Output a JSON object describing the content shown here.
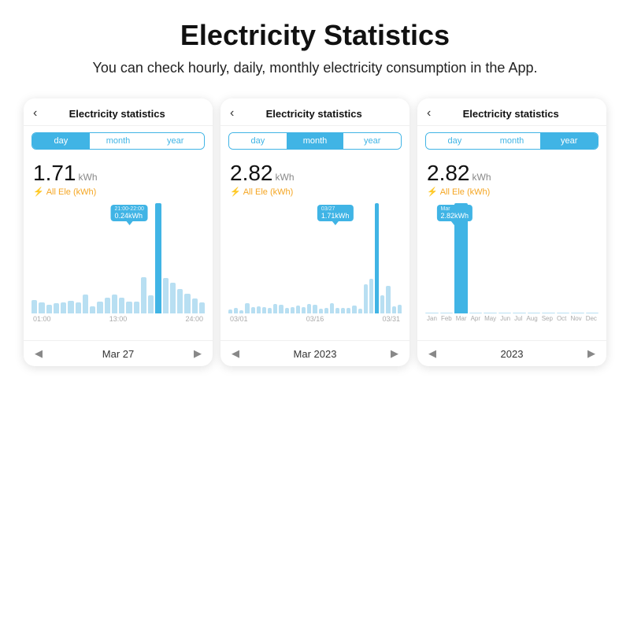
{
  "header": {
    "title": "Electricity Statistics",
    "subtitle": "You can check hourly, daily, monthly electricity consumption in the App."
  },
  "phones": [
    {
      "id": "day-view",
      "title": "Electricity statistics",
      "tabs": [
        "day",
        "month",
        "year"
      ],
      "active_tab": 0,
      "kwh_value": "1.71",
      "kwh_unit": "kWh",
      "kwh_label": "All Ele (kWh)",
      "tooltip": "0.24kWh",
      "tooltip_sub": "21:00-22:00",
      "x_labels": [
        "01:00",
        "13:00",
        "24:00"
      ],
      "nav_label": "Mar 27",
      "highlight_bar": 17
    },
    {
      "id": "month-view",
      "title": "Electricity statistics",
      "tabs": [
        "day",
        "month",
        "year"
      ],
      "active_tab": 1,
      "kwh_value": "2.82",
      "kwh_unit": "kWh",
      "kwh_label": "All Ele (kWh)",
      "tooltip": "1.71kWh",
      "tooltip_sub": "03/27",
      "x_labels": [
        "03/01",
        "03/16",
        "03/31"
      ],
      "nav_label": "Mar 2023",
      "highlight_bar": 26
    },
    {
      "id": "year-view",
      "title": "Electricity statistics",
      "tabs": [
        "day",
        "month",
        "year"
      ],
      "active_tab": 2,
      "kwh_value": "2.82",
      "kwh_unit": "kWh",
      "kwh_label": "All Ele (kWh)",
      "tooltip": "2.82kWh",
      "tooltip_sub": "Mar",
      "x_labels": [
        "Jan",
        "Feb",
        "Mar",
        "Apr",
        "May",
        "Jun",
        "Jul",
        "Aug",
        "Sep",
        "Oct",
        "Nov",
        "Dec"
      ],
      "nav_label": "2023",
      "highlight_bar": 2
    }
  ],
  "colors": {
    "accent": "#40b4e5",
    "bar_light": "#b8dff2",
    "bar_highlight": "#40b4e5"
  }
}
